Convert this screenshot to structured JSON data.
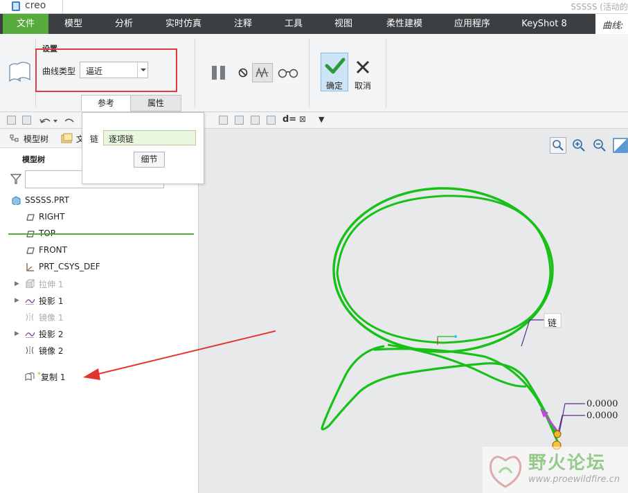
{
  "app": {
    "logo_text": "creo",
    "window_title": "SSSSS (活动的"
  },
  "menu": {
    "items": [
      "文件",
      "模型",
      "分析",
      "实时仿真",
      "注释",
      "工具",
      "视图",
      "柔性建模",
      "应用程序",
      "KeyShot 8"
    ],
    "right_text": "曲线:"
  },
  "ribbon": {
    "group_label": "设置",
    "curve_type_label": "曲线类型",
    "curve_type_value": "逼近",
    "tabs": [
      "参考",
      "属性"
    ],
    "ok_label": "确定",
    "cancel_label": "取消"
  },
  "toolbar2": {
    "d_label": "d=",
    "x_label": "⊠"
  },
  "panel": {
    "tab_model_tree": "模型树",
    "tab_files": "文",
    "tree_title": "模型树",
    "items": [
      {
        "label": "SSSSS.PRT",
        "icon": "part-icon"
      },
      {
        "label": "RIGHT",
        "icon": "datum-plane-icon"
      },
      {
        "label": "TOP",
        "icon": "datum-plane-icon"
      },
      {
        "label": "FRONT",
        "icon": "datum-plane-icon"
      },
      {
        "label": "PRT_CSYS_DEF",
        "icon": "csys-icon"
      },
      {
        "label": "拉伸 1",
        "icon": "extrude-icon"
      },
      {
        "label": "投影 1",
        "icon": "projection-icon"
      },
      {
        "label": "镜像 1",
        "icon": "mirror-icon"
      },
      {
        "label": "投影 2",
        "icon": "projection-icon"
      },
      {
        "label": "镜像 2",
        "icon": "mirror-icon"
      },
      {
        "label": "复制 1",
        "icon": "copy-curve-icon"
      }
    ]
  },
  "ref_popup": {
    "chain_label": "链",
    "chain_value": "逐项链",
    "detail_button": "细节"
  },
  "graphics": {
    "chain_annotation": "链",
    "dim1": "0.0000",
    "dim2": "0.0000",
    "curve_color": "#18c018"
  },
  "watermark": {
    "text": "野火论坛",
    "url": "www.proewildfire.cn"
  }
}
